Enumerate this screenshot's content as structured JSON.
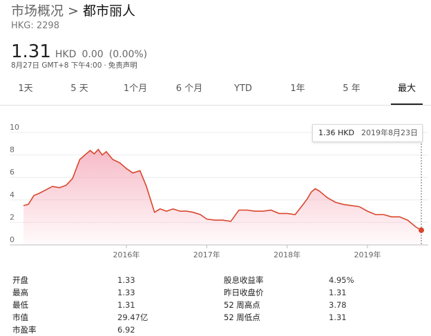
{
  "header": {
    "market": "市场概况",
    "separator": ">",
    "company": "都市丽人",
    "ticker": "HKG: 2298"
  },
  "quote": {
    "price": "1.31",
    "currency": "HKD",
    "change": "0.00",
    "change_pct": "(0.00%)",
    "timestamp": "8月27日 GMT+8 下午4:00",
    "dot": "·",
    "disclaimer": "免责声明"
  },
  "tabs": [
    {
      "label": "1天"
    },
    {
      "label": "5 天"
    },
    {
      "label": "1个月"
    },
    {
      "label": "6 个月"
    },
    {
      "label": "YTD"
    },
    {
      "label": "1年"
    },
    {
      "label": "5 年"
    },
    {
      "label": "最大",
      "active": true
    }
  ],
  "tooltip": {
    "price": "1.36 HKD",
    "date": "2019年8月23日"
  },
  "chart_data": {
    "type": "area",
    "y_ticks": [
      0,
      2,
      4,
      6,
      8,
      10
    ],
    "ylim": [
      0,
      10
    ],
    "x_tick_labels": [
      "2016年",
      "2017年",
      "2018年",
      "2019年"
    ],
    "x_tick_years": [
      2016,
      2017,
      2018,
      2019
    ],
    "xlim": [
      2014.72,
      2019.67
    ],
    "grid": true,
    "line_color": "#d9452b",
    "fill_color": "#f4a3b4",
    "series": [
      {
        "x": [
          2014.72,
          2014.78,
          2014.85,
          2014.92,
          2015.0,
          2015.08,
          2015.17,
          2015.25,
          2015.33,
          2015.42,
          2015.5,
          2015.55,
          2015.6,
          2015.65,
          2015.7,
          2015.75,
          2015.83,
          2015.92,
          2016.0,
          2016.08,
          2016.17,
          2016.25,
          2016.35,
          2016.42,
          2016.5,
          2016.58,
          2016.67,
          2016.75,
          2016.83,
          2016.92,
          2017.0,
          2017.1,
          2017.2,
          2017.3,
          2017.4,
          2017.5,
          2017.6,
          2017.7,
          2017.8,
          2017.9,
          2018.0,
          2018.1,
          2018.2,
          2018.25,
          2018.3,
          2018.35,
          2018.4,
          2018.5,
          2018.6,
          2018.7,
          2018.8,
          2018.9,
          2019.0,
          2019.1,
          2019.2,
          2019.3,
          2019.4,
          2019.5,
          2019.6,
          2019.67
        ],
        "y": [
          3.5,
          3.6,
          4.4,
          4.6,
          4.9,
          5.2,
          5.1,
          5.3,
          5.9,
          7.6,
          8.1,
          8.4,
          8.1,
          8.5,
          8.0,
          8.3,
          7.6,
          7.3,
          6.8,
          6.4,
          6.6,
          5.2,
          2.9,
          3.2,
          3.0,
          3.2,
          3.0,
          3.0,
          2.9,
          2.7,
          2.3,
          2.2,
          2.2,
          2.1,
          3.1,
          3.1,
          3.0,
          3.0,
          3.1,
          2.8,
          2.8,
          2.7,
          3.6,
          4.1,
          4.7,
          5.0,
          4.8,
          4.2,
          3.8,
          3.6,
          3.5,
          3.4,
          3.0,
          2.7,
          2.7,
          2.5,
          2.5,
          2.2,
          1.6,
          1.31
        ]
      }
    ]
  },
  "stats": {
    "rows": [
      {
        "l1": "开盘",
        "v1": "1.33",
        "l2": "股息收益率",
        "v2": "4.95%"
      },
      {
        "l1": "最高",
        "v1": "1.33",
        "l2": "昨日收盘价",
        "v2": "1.31"
      },
      {
        "l1": "最低",
        "v1": "1.31",
        "l2": "52 周高点",
        "v2": "3.78"
      },
      {
        "l1": "市值",
        "v1": "29.47亿",
        "l2": "52 周低点",
        "v2": "1.31"
      },
      {
        "l1": "市盈率",
        "v1": "6.92",
        "l2": "",
        "v2": ""
      }
    ]
  }
}
